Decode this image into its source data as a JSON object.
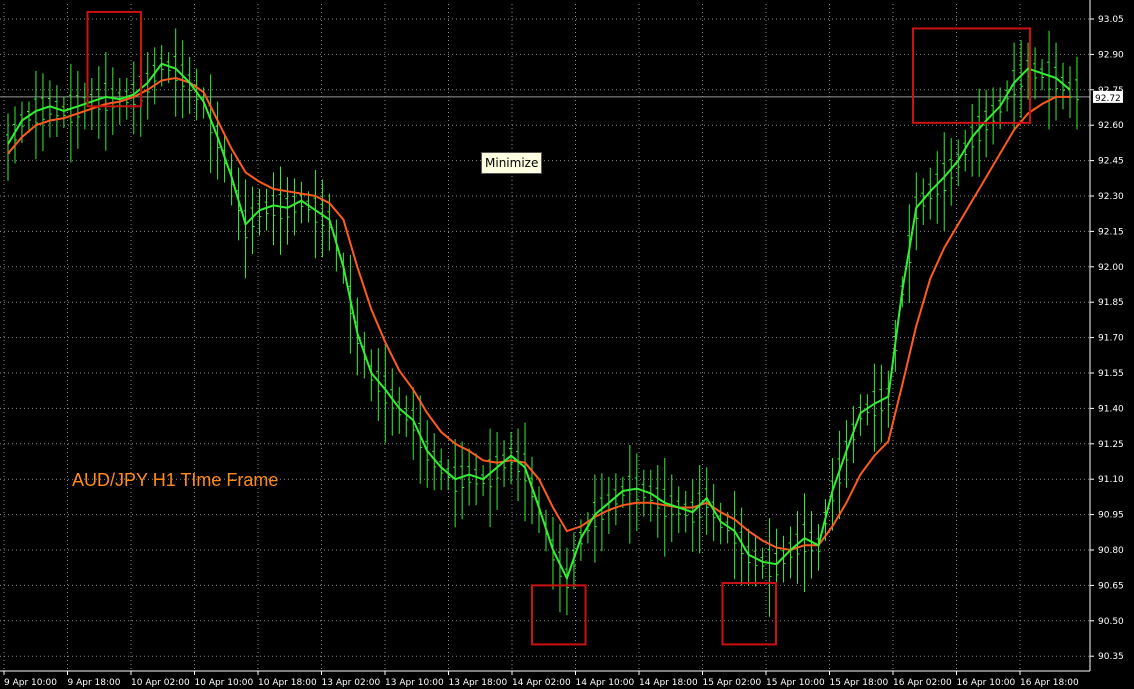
{
  "tooltip": "Minimize",
  "chart_data": {
    "type": "line",
    "title": "AUD/JPY H1 TIme Frame",
    "symbol_price_label": "92.72",
    "ylim": [
      90.35,
      93.1
    ],
    "y_ticks": [
      "93.05",
      "92.90",
      "92.75",
      "92.60",
      "92.45",
      "92.30",
      "92.15",
      "92.00",
      "91.85",
      "91.70",
      "91.55",
      "91.40",
      "91.25",
      "91.10",
      "90.95",
      "90.80",
      "90.65",
      "90.50",
      "90.35"
    ],
    "x_ticks": [
      "9 Apr 10:00",
      "9 Apr 18:00",
      "10 Apr 02:00",
      "10 Apr 10:00",
      "10 Apr 18:00",
      "13 Apr 02:00",
      "13 Apr 10:00",
      "13 Apr 18:00",
      "14 Apr 02:00",
      "14 Apr 10:00",
      "14 Apr 18:00",
      "15 Apr 02:00",
      "15 Apr 10:00",
      "15 Apr 18:00",
      "16 Apr 02:00",
      "16 Apr 10:00",
      "16 Apr 18:00"
    ],
    "grid": true,
    "colors": {
      "background": "#000000",
      "grid": "#8a8a8a",
      "bars": "#33ee33",
      "fast_ma": "#33ee33",
      "slow_ma": "#ff5a1f",
      "highlight_box": "#cc1111",
      "title": "#ff8c1a"
    },
    "series": [
      {
        "values": [
          92.52,
          92.62,
          92.66,
          92.68,
          92.66,
          92.68,
          92.7,
          92.72,
          92.71,
          92.73,
          92.78,
          92.86,
          92.84,
          92.78,
          92.7,
          92.55,
          92.38,
          92.18,
          92.24,
          92.26,
          92.25,
          92.28,
          92.24,
          92.2,
          92.0,
          91.72,
          91.55,
          91.48,
          91.4,
          91.35,
          91.22,
          91.15,
          91.1,
          91.12,
          91.1,
          91.15,
          91.2,
          91.15,
          90.98,
          90.8,
          90.68,
          90.85,
          90.95,
          91.0,
          91.05,
          91.06,
          91.04,
          91.0,
          90.98,
          90.96,
          91.02,
          90.92,
          90.88,
          90.78,
          90.75,
          90.74,
          90.8,
          90.85,
          90.82,
          91.05,
          91.22,
          91.38,
          91.42,
          91.45,
          91.9,
          92.25,
          92.32,
          92.38,
          92.45,
          92.55,
          92.62,
          92.68,
          92.78,
          92.84,
          92.82,
          92.8,
          92.75
        ]
      },
      {
        "values": [
          92.48,
          92.55,
          92.6,
          92.62,
          92.63,
          92.65,
          92.67,
          92.69,
          92.7,
          92.72,
          92.75,
          92.79,
          92.8,
          92.78,
          92.74,
          92.62,
          92.5,
          92.4,
          92.36,
          92.33,
          92.32,
          92.31,
          92.3,
          92.27,
          92.2,
          92.0,
          91.82,
          91.68,
          91.56,
          91.48,
          91.38,
          91.3,
          91.25,
          91.22,
          91.18,
          91.17,
          91.18,
          91.17,
          91.1,
          90.98,
          90.88,
          90.9,
          90.94,
          90.97,
          90.99,
          91.0,
          91.0,
          90.99,
          90.98,
          90.98,
          91.0,
          90.96,
          90.93,
          90.88,
          90.84,
          90.81,
          90.8,
          90.82,
          90.82,
          90.9,
          91.0,
          91.12,
          91.2,
          91.26,
          91.5,
          91.75,
          91.95,
          92.08,
          92.18,
          92.28,
          92.38,
          92.48,
          92.58,
          92.65,
          92.69,
          92.72,
          92.72
        ]
      }
    ],
    "highlight_boxes": [
      {
        "label": "top-left",
        "x_range": [
          "9 Apr 18:00",
          "10 Apr 02:00"
        ],
        "y_range": [
          92.68,
          93.08
        ]
      },
      {
        "label": "bottom-middle",
        "x_range": [
          "14 Apr 02:00",
          "14 Apr 10:00"
        ],
        "y_range": [
          90.4,
          90.65
        ]
      },
      {
        "label": "bottom-right",
        "x_range": [
          "15 Apr 02:00",
          "15 Apr 10:00"
        ],
        "y_range": [
          90.4,
          90.66
        ]
      },
      {
        "label": "top-right",
        "x_range": [
          "16 Apr 02:00",
          "16 Apr 18:00"
        ],
        "y_range": [
          92.61,
          93.01
        ]
      }
    ]
  }
}
